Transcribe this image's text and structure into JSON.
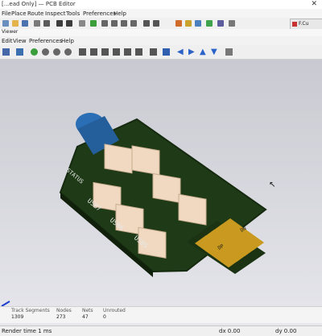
{
  "outer": {
    "title": "[Read Only] — PCB Editor",
    "title_fragment_left": "[...ead Only] — PCB Editor",
    "menu": [
      "File",
      "Place",
      "Route",
      "Inspect",
      "Tools",
      "Preferences",
      "Help"
    ],
    "right_tab": "F.Cu"
  },
  "viewer": {
    "title": "Viewer",
    "menu": [
      "Edit",
      "View",
      "Preferences",
      "Help"
    ]
  },
  "board": {
    "silk": [
      "STATUS",
      "USB7",
      "USB6",
      "USB5",
      "DN",
      "DP"
    ]
  },
  "status": {
    "render_time": "Render time 1 ms",
    "dx": "dx 0.00",
    "dy": "dy 0.00"
  },
  "stats": {
    "labels": [
      "Track Segments",
      "Nodes",
      "Nets",
      "Unrouted"
    ],
    "values": [
      "1309",
      "273",
      "47",
      "0"
    ]
  },
  "colors": {
    "board": "#1f3a16",
    "connector": "#f0d9c0",
    "gold": "#c99a1f",
    "capacitor": "#2a6fb5"
  }
}
